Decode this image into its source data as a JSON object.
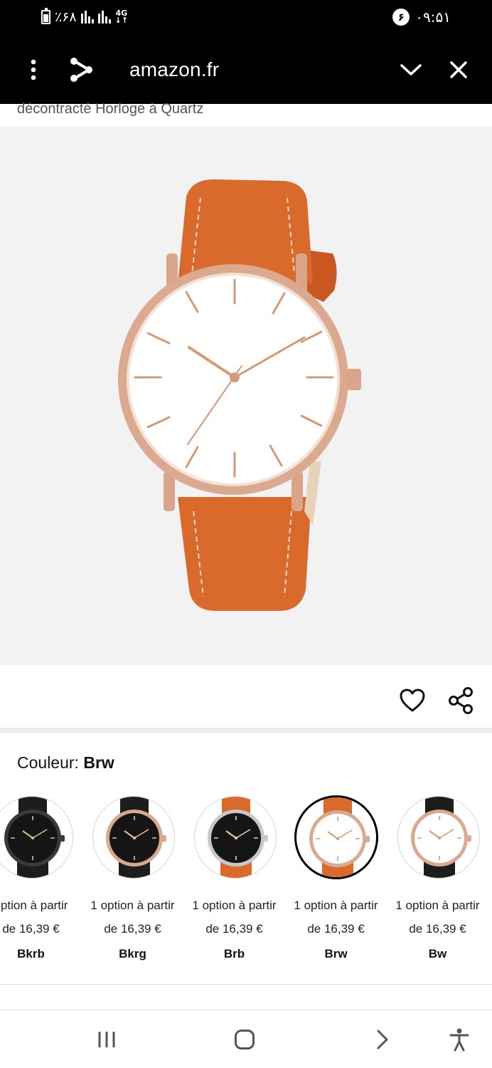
{
  "status_bar": {
    "battery_text": "٪۶۸",
    "network": "4G",
    "notification_count": "۶",
    "time": "۰۹:۵۱"
  },
  "toolbar": {
    "menu_icon": "more-vert-icon",
    "share_icon": "share-icon",
    "domain": "amazon.fr",
    "collapse_icon": "chevron-down-icon",
    "close_icon": "close-icon"
  },
  "product": {
    "title_fragment": "décontracté Horloge à Quartz",
    "image_alt": "watch",
    "wishlist_icon": "heart-icon",
    "share_icon": "share-icon"
  },
  "color_selector": {
    "label": "Couleur:",
    "selected_value": "Brw",
    "options": [
      {
        "option_text": "option à partir",
        "price_text": "de 16,39 €",
        "code": "Bkrb",
        "dial": "#151515",
        "strap": "#1d1d1d",
        "case": "#3a3a3a",
        "hands": "#d9c08a",
        "selected": false
      },
      {
        "option_text": "1 option à partir",
        "price_text": "de 16,39 €",
        "code": "Bkrg",
        "dial": "#151515",
        "strap": "#1d1d1d",
        "case": "#d8a98c",
        "hands": "#e8c4a8",
        "selected": false
      },
      {
        "option_text": "1 option à partir",
        "price_text": "de 16,39 €",
        "code": "Brb",
        "dial": "#151515",
        "strap": "#d96a2b",
        "case": "#c8c8c8",
        "hands": "#e8d8a8",
        "selected": false
      },
      {
        "option_text": "1 option à partir",
        "price_text": "de 16,39 €",
        "code": "Brw",
        "dial": "#ffffff",
        "strap": "#d96a2b",
        "case": "#dba890",
        "hands": "#d39a78",
        "selected": true
      },
      {
        "option_text": "1 option à partir",
        "price_text": "de 16,39 €",
        "code": "Bw",
        "dial": "#ffffff",
        "strap": "#1d1d1d",
        "case": "#dba890",
        "hands": "#d39a78",
        "selected": false
      }
    ]
  },
  "nav_bar": {
    "recents_icon": "recents-icon",
    "home_icon": "home-icon",
    "back_icon": "chevron-right-icon",
    "accessibility_icon": "accessibility-icon"
  },
  "colors": {
    "toolbar_bg": "#000000",
    "image_bg": "#f2f2f2",
    "strap_orange": "#d96a2b",
    "rose_gold": "#dba890"
  }
}
